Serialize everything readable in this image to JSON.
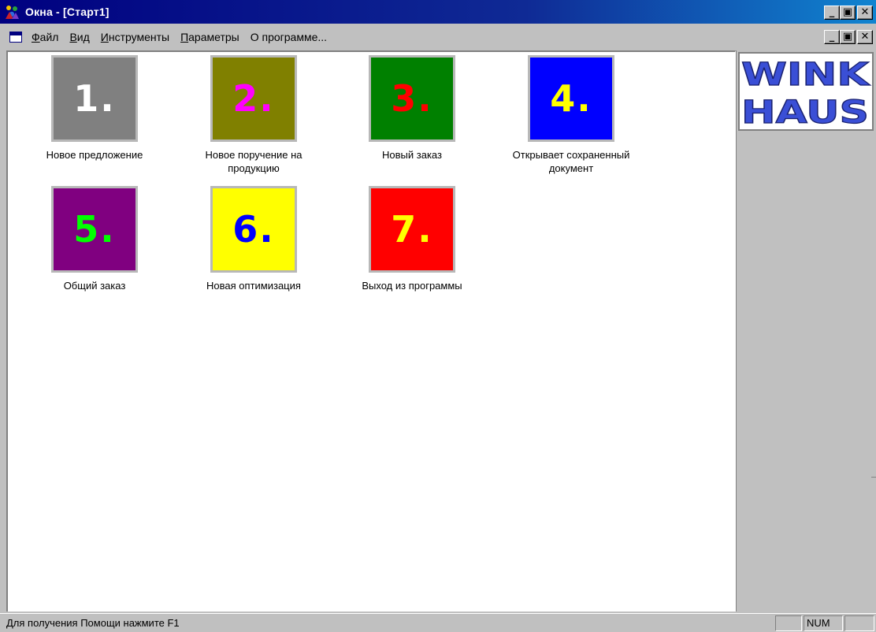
{
  "window": {
    "title": "Окна - [Старт1]"
  },
  "menu": {
    "items": [
      {
        "accel": "Ф",
        "rest": "айл"
      },
      {
        "accel": "В",
        "rest": "ид"
      },
      {
        "accel": "И",
        "rest": "нструменты"
      },
      {
        "accel": "П",
        "rest": "араметры"
      },
      {
        "accel": "",
        "rest": "О программе..."
      }
    ]
  },
  "tiles": [
    {
      "number": "1.",
      "label": "Новое предложение",
      "bg": "#808080",
      "fg": "#ffffff"
    },
    {
      "number": "2.",
      "label": "Новое поручение на\nпродукцию",
      "bg": "#808000",
      "fg": "#ff00ff"
    },
    {
      "number": "3.",
      "label": "Новый заказ",
      "bg": "#008000",
      "fg": "#ff0000"
    },
    {
      "number": "4.",
      "label": "Открывает сохраненный\nдокумент",
      "bg": "#0000ff",
      "fg": "#ffff00"
    },
    {
      "number": "5.",
      "label": "Общий заказ",
      "bg": "#800080",
      "fg": "#00ff00"
    },
    {
      "number": "6.",
      "label": "Новая оптимизация",
      "bg": "#ffff00",
      "fg": "#0000ff"
    },
    {
      "number": "7.",
      "label": "Выход из программы",
      "bg": "#ff0000",
      "fg": "#ffff00"
    }
  ],
  "logo": {
    "line1": "WINK",
    "line2": "HAUS",
    "color": "#3a4fd6"
  },
  "statusbar": {
    "text": "Для получения Помощи нажмите  F1",
    "num": "NUM"
  }
}
